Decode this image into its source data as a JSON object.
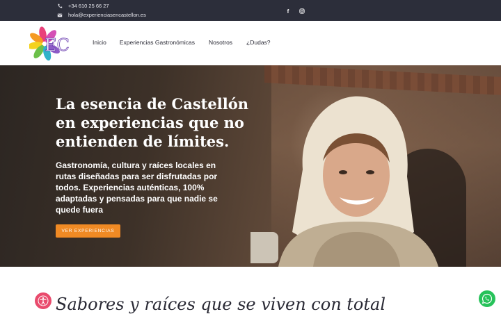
{
  "topbar": {
    "phone": "+34 610 25 66 27",
    "email": "hola@experienciasencastellon.es",
    "social": [
      {
        "icon": "facebook-icon",
        "glyph": "f"
      },
      {
        "icon": "instagram-icon",
        "glyph": "◎"
      }
    ]
  },
  "header": {
    "logo_text": "EC",
    "nav": [
      "Inicio",
      "Experiencias Gastronómicas",
      "Nosotros",
      "¿Dudas?"
    ]
  },
  "hero": {
    "title": "La esencia de Castellón\nen experiencias que no\nentienden de límites.",
    "subtitle": "Gastronomía, cultura y raíces locales en rutas diseñadas para ser disfrutadas por todos. Experiencias auténticas, 100% adaptadas y pensadas para que nadie se quede fuera",
    "cta": "VER EXPERIENCIAS"
  },
  "section": {
    "title": "Sabores y raíces que se viven con total"
  },
  "colors": {
    "topbar_bg": "#2c2e3a",
    "cta": "#f08a24",
    "accessibility": "#e94b6d",
    "whatsapp": "#27c25a"
  },
  "floating": {
    "accessibility_icon": "accessibility-icon",
    "whatsapp_icon": "whatsapp-icon"
  }
}
